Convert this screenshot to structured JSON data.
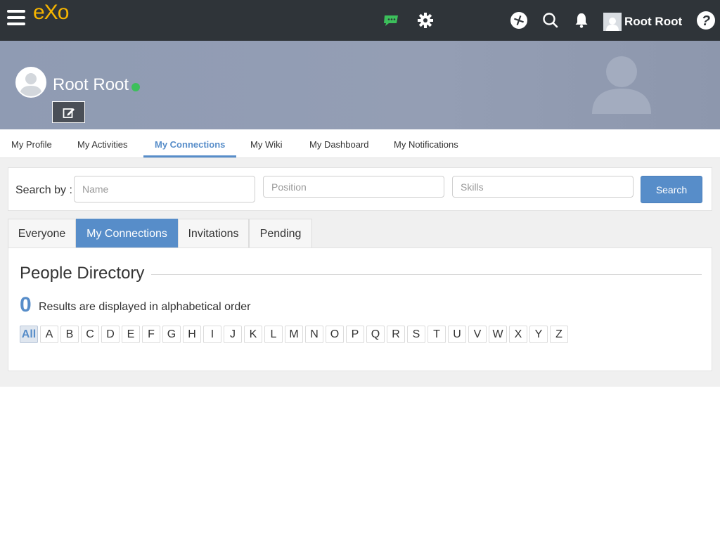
{
  "topbar": {
    "logo": "eXo",
    "user_name": "Root Root",
    "icons": [
      "menu-icon",
      "chat-icon",
      "gear-icon",
      "add-icon",
      "search-icon",
      "bell-icon",
      "help-icon"
    ],
    "colors": {
      "background": "#2f3439",
      "logo": "#f5b400",
      "chat": "#3cbf5b"
    }
  },
  "profile": {
    "name": "Root Root",
    "status": "online",
    "status_color": "#3cbf5b"
  },
  "profile_nav": {
    "items": [
      {
        "label": "My Profile",
        "active": false
      },
      {
        "label": "My Activities",
        "active": false
      },
      {
        "label": "My Connections",
        "active": true
      },
      {
        "label": "My Wiki",
        "active": false
      },
      {
        "label": "My Dashboard",
        "active": false
      },
      {
        "label": "My Notifications",
        "active": false
      }
    ],
    "accent": "#578dc9"
  },
  "search": {
    "label": "Search by :",
    "name_placeholder": "Name",
    "position_placeholder": "Position",
    "skills_placeholder": "Skills",
    "button": "Search"
  },
  "directory_tabs": [
    {
      "label": "Everyone",
      "active": false
    },
    {
      "label": "My Connections",
      "active": true
    },
    {
      "label": "Invitations",
      "active": false
    },
    {
      "label": "Pending",
      "active": false
    }
  ],
  "directory": {
    "title": "People Directory",
    "count": "0",
    "results_text": "Results are displayed in alphabetical order",
    "letters": [
      "All",
      "A",
      "B",
      "C",
      "D",
      "E",
      "F",
      "G",
      "H",
      "I",
      "J",
      "K",
      "L",
      "M",
      "N",
      "O",
      "P",
      "Q",
      "R",
      "S",
      "T",
      "U",
      "V",
      "W",
      "X",
      "Y",
      "Z"
    ],
    "active_letter": "All"
  }
}
